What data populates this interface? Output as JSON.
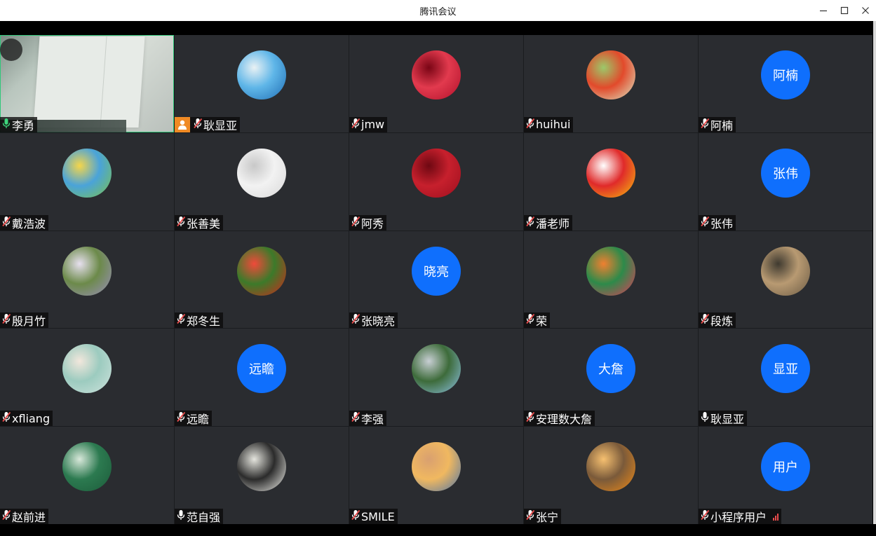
{
  "window": {
    "title": "腾讯会议",
    "controls": [
      "minimize-icon",
      "maximize-icon",
      "close-icon"
    ]
  },
  "colors": {
    "tile_bg": "#2a2c30",
    "text_avatar_bg": "#0f6ffd",
    "active_speaker_border": "#2fc87a",
    "host_badge": "#f08a24",
    "muted_mic_slash": "#e84b4b"
  },
  "participants": [
    {
      "name": "李勇",
      "mic": "active",
      "video": "camera",
      "active_speaker": true
    },
    {
      "name": "耿显亚",
      "mic": "muted",
      "host": true,
      "avatar": "beach-photo",
      "avatar_colors": [
        "#1f6db3",
        "#5fb6e8",
        "#e9f1f4"
      ]
    },
    {
      "name": "jmw",
      "mic": "muted",
      "avatar": "red-flower-photo",
      "avatar_colors": [
        "#b0102a",
        "#e23a4e",
        "#7a0515"
      ]
    },
    {
      "name": "huihui",
      "mic": "muted",
      "avatar": "cartoon-fox",
      "avatar_colors": [
        "#dbe9c5",
        "#e24a2b",
        "#9bc96a"
      ]
    },
    {
      "name": "阿楠",
      "mic": "muted",
      "avatar_text": "阿楠"
    },
    {
      "name": "戴浩波",
      "mic": "muted",
      "avatar": "cartoon-farm",
      "avatar_colors": [
        "#7cc24a",
        "#4aa3d9",
        "#f5d64a"
      ]
    },
    {
      "name": "张善美",
      "mic": "muted",
      "avatar": "default-person",
      "avatar_colors": [
        "#d9d9d9",
        "#f2f2f2",
        "#c8c8c8"
      ]
    },
    {
      "name": "阿秀",
      "mic": "muted",
      "avatar": "red-calligraphy",
      "avatar_colors": [
        "#9d0f1e",
        "#c7202d",
        "#6e0812"
      ]
    },
    {
      "name": "潘老师",
      "mic": "muted",
      "avatar": "cartoon-girl-1212",
      "avatar_colors": [
        "#f5c20c",
        "#e02a2a",
        "#ffffff"
      ]
    },
    {
      "name": "张伟",
      "mic": "muted",
      "avatar_text": "张伟"
    },
    {
      "name": "殷月竹",
      "mic": "muted",
      "avatar": "lavender-field-photo",
      "avatar_colors": [
        "#9a8fbd",
        "#6c8a4a",
        "#e7e0ef"
      ]
    },
    {
      "name": "郑冬生",
      "mic": "muted",
      "avatar": "cherries-photo",
      "avatar_colors": [
        "#d2261c",
        "#3c7a2a",
        "#f04a3a"
      ]
    },
    {
      "name": "张晓亮",
      "mic": "muted",
      "avatar_text": "晓亮"
    },
    {
      "name": "荣",
      "mic": "muted",
      "avatar": "flowers-photo",
      "avatar_colors": [
        "#e43a5a",
        "#2d8a4a",
        "#f08030"
      ]
    },
    {
      "name": "段炼",
      "mic": "muted",
      "avatar": "family-photo",
      "avatar_colors": [
        "#6a5a44",
        "#b89a72",
        "#3f3a30"
      ]
    },
    {
      "name": "xfliang",
      "mic": "muted",
      "avatar": "baby-photo",
      "avatar_colors": [
        "#cfe3dd",
        "#9ccbbf",
        "#f2e7dc"
      ]
    },
    {
      "name": "远瞻",
      "mic": "muted",
      "avatar_text": "远瞻"
    },
    {
      "name": "李强",
      "mic": "muted",
      "avatar": "mountain-pine-photo",
      "avatar_colors": [
        "#8fc3e6",
        "#3d6b3a",
        "#c8cfd4"
      ]
    },
    {
      "name": "安理数大詹",
      "mic": "muted",
      "avatar_text": "大詹"
    },
    {
      "name": "耿显亚",
      "mic": "unmuted",
      "avatar_text": "显亚"
    },
    {
      "name": "赵前进",
      "mic": "muted",
      "avatar": "chalkboard-math",
      "avatar_colors": [
        "#1c5b3a",
        "#2c7a50",
        "#d8e8da"
      ]
    },
    {
      "name": "范自强",
      "mic": "unmuted",
      "avatar": "pig-sketch",
      "avatar_colors": [
        "#f6f6f1",
        "#2b2b2b",
        "#e5e5de"
      ]
    },
    {
      "name": "SMILE",
      "mic": "muted",
      "avatar": "sunset-couple-photo",
      "avatar_colors": [
        "#4d74a8",
        "#f0b860",
        "#d9a070"
      ]
    },
    {
      "name": "张宁",
      "mic": "muted",
      "avatar": "orange-sunset-photo",
      "avatar_colors": [
        "#ef8a17",
        "#7a5a3a",
        "#f6c070"
      ]
    },
    {
      "name": "小程序用户",
      "mic": "muted",
      "avatar_text": "用户",
      "signal": "weak"
    }
  ]
}
